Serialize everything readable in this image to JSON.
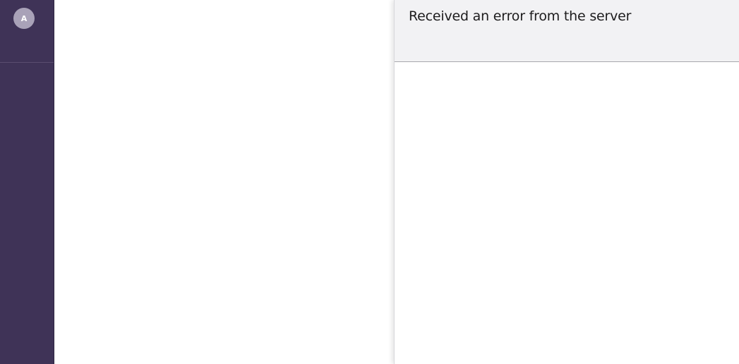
{
  "sidebar": {
    "avatar_initial": "A"
  },
  "panel": {
    "title": "Received an error from the server"
  },
  "colors": {
    "sidebar_bg": "#3f3357",
    "avatar_bg": "#a9a2b8",
    "panel_header_bg": "#f2f2f4"
  }
}
